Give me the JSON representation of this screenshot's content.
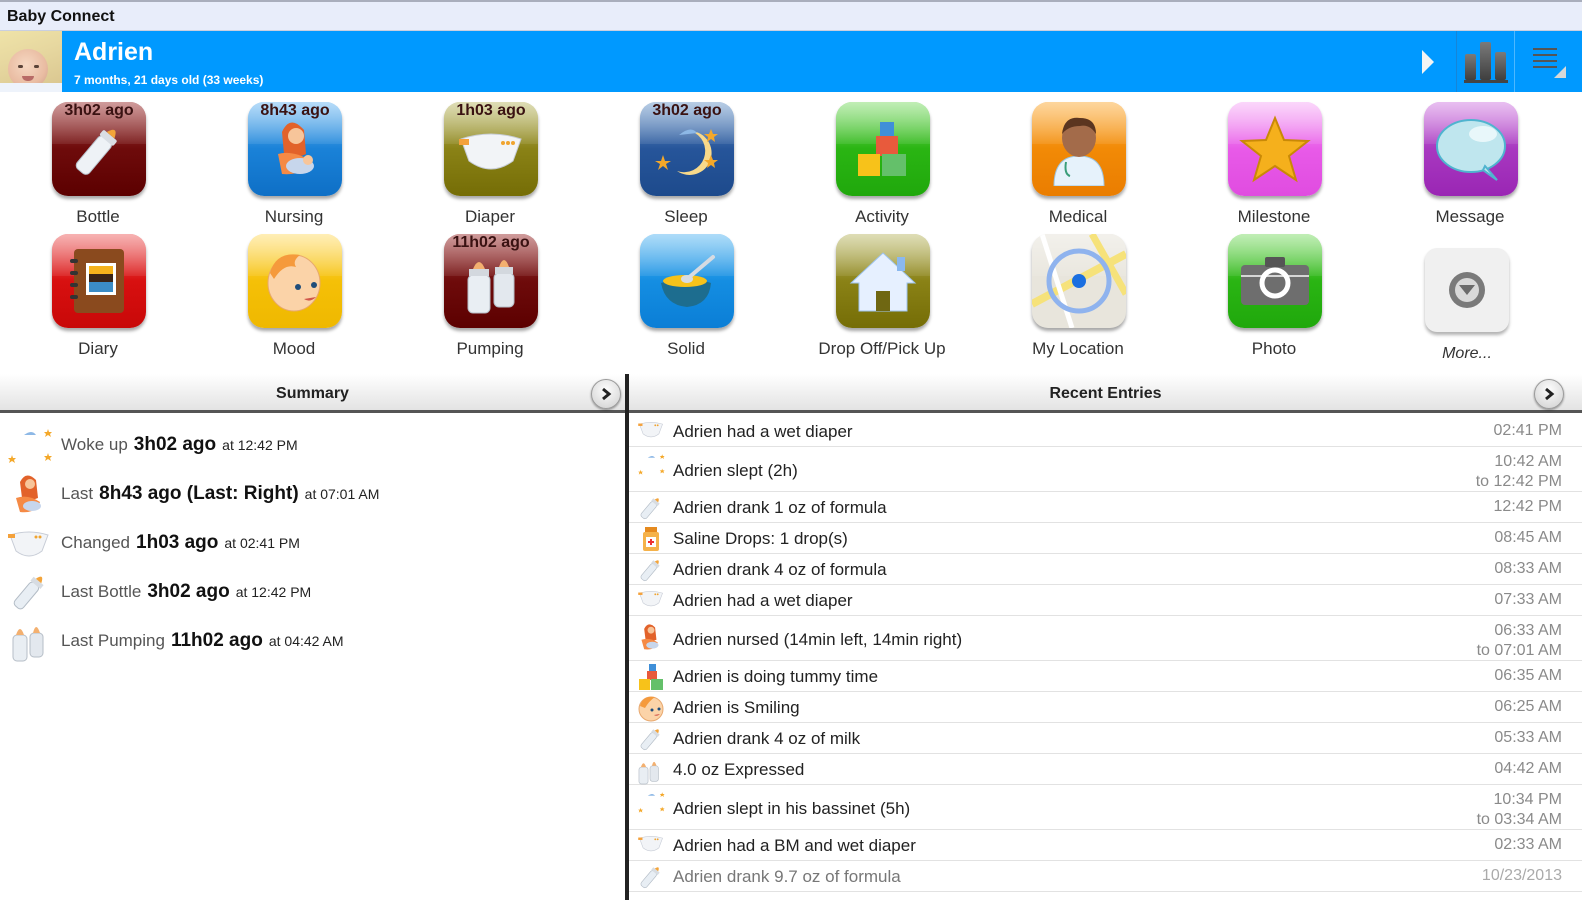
{
  "app": {
    "title": "Baby Connect"
  },
  "header": {
    "child_name": "Adrien",
    "child_age": "7 months, 21 days old (33 weeks)",
    "next_icon": "play-right-icon",
    "chart_icon": "bar-chart-icon",
    "menu_icon": "overflow-menu-icon",
    "accent_color": "#0099ff"
  },
  "tiles": [
    {
      "label": "Bottle",
      "badge": "3h02 ago",
      "icon": "bottle-icon"
    },
    {
      "label": "Nursing",
      "badge": "8h43 ago",
      "icon": "nursing-icon"
    },
    {
      "label": "Diaper",
      "badge": "1h03 ago",
      "icon": "diaper-icon"
    },
    {
      "label": "Sleep",
      "badge": "3h02 ago",
      "icon": "moon-sleep-icon"
    },
    {
      "label": "Activity",
      "badge": "",
      "icon": "blocks-icon"
    },
    {
      "label": "Medical",
      "badge": "",
      "icon": "doctor-icon"
    },
    {
      "label": "Milestone",
      "badge": "",
      "icon": "star-icon"
    },
    {
      "label": "Message",
      "badge": "",
      "icon": "speech-bubble-icon"
    },
    {
      "label": "Diary",
      "badge": "",
      "icon": "diary-book-icon"
    },
    {
      "label": "Mood",
      "badge": "",
      "icon": "baby-face-icon"
    },
    {
      "label": "Pumping",
      "badge": "11h02 ago",
      "icon": "pump-bottles-icon"
    },
    {
      "label": "Solid",
      "badge": "",
      "icon": "food-bowl-icon"
    },
    {
      "label": "Drop Off/Pick Up",
      "badge": "",
      "icon": "house-icon"
    },
    {
      "label": "My Location",
      "badge": "",
      "icon": "map-location-icon"
    },
    {
      "label": "Photo",
      "badge": "",
      "icon": "camera-icon"
    },
    {
      "label": "More...",
      "badge": "",
      "icon": "more-down-icon"
    }
  ],
  "summary": {
    "title": "Summary",
    "rows": [
      {
        "label": "Woke up",
        "value": "3h02 ago",
        "at": "at 12:42 PM",
        "icon": "moon-sleep-icon"
      },
      {
        "label": "Last",
        "value": "8h43 ago (Last: Right)",
        "at": "at 07:01 AM",
        "icon": "nursing-icon"
      },
      {
        "label": "Changed",
        "value": "1h03 ago",
        "at": "at 02:41 PM",
        "icon": "diaper-icon"
      },
      {
        "label": "Last Bottle",
        "value": "3h02 ago",
        "at": "at 12:42 PM",
        "icon": "bottle-icon"
      },
      {
        "label": "Last Pumping",
        "value": "11h02 ago",
        "at": "at 04:42 AM",
        "icon": "pump-bottles-icon"
      }
    ]
  },
  "recent": {
    "title": "Recent Entries",
    "entries": [
      {
        "text": "Adrien had a wet diaper",
        "time": "02:41 PM",
        "time2": "",
        "icon": "diaper-icon"
      },
      {
        "text": "Adrien slept (2h)",
        "time": "10:42 AM",
        "time2": "to 12:42 PM",
        "icon": "moon-sleep-icon"
      },
      {
        "text": "Adrien drank 1 oz of formula",
        "time": "12:42 PM",
        "time2": "",
        "icon": "bottle-icon"
      },
      {
        "text": "Saline Drops: 1 drop(s)",
        "time": "08:45 AM",
        "time2": "",
        "icon": "medicine-bottle-icon"
      },
      {
        "text": "Adrien drank 4 oz of formula",
        "time": "08:33 AM",
        "time2": "",
        "icon": "bottle-icon"
      },
      {
        "text": "Adrien had a wet diaper",
        "time": "07:33 AM",
        "time2": "",
        "icon": "diaper-icon"
      },
      {
        "text": "Adrien nursed (14min left, 14min right)",
        "time": "06:33 AM",
        "time2": "to 07:01 AM",
        "icon": "nursing-icon"
      },
      {
        "text": "Adrien is doing tummy time",
        "time": "06:35 AM",
        "time2": "",
        "icon": "blocks-icon"
      },
      {
        "text": "Adrien is Smiling",
        "time": "06:25 AM",
        "time2": "",
        "icon": "baby-face-icon"
      },
      {
        "text": "Adrien drank 4 oz of milk",
        "time": "05:33 AM",
        "time2": "",
        "icon": "bottle-icon"
      },
      {
        "text": "4.0 oz Expressed",
        "time": "04:42 AM",
        "time2": "",
        "icon": "pump-bottles-icon"
      },
      {
        "text": "Adrien slept in his bassinet (5h)",
        "time": "10:34 PM",
        "time2": "to 03:34 AM",
        "icon": "moon-sleep-icon"
      },
      {
        "text": "Adrien had a BM and wet diaper",
        "time": "02:33 AM",
        "time2": "",
        "icon": "diaper-icon"
      },
      {
        "text": "Adrien drank 9.7 oz of formula",
        "time": "10/23/2013",
        "time2": "",
        "icon": "bottle-icon"
      }
    ]
  }
}
